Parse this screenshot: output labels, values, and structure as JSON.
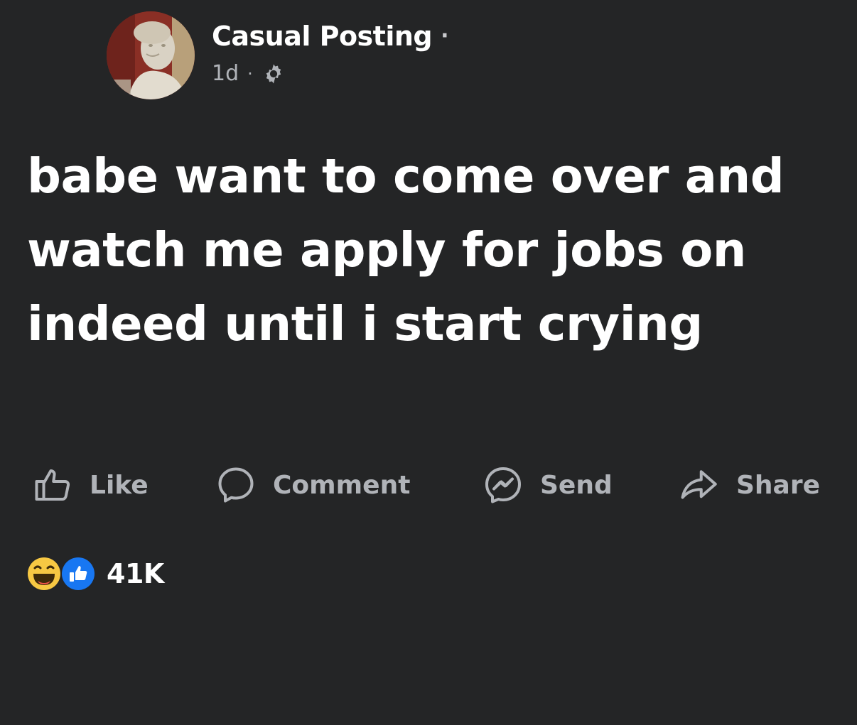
{
  "post": {
    "author": "Casual Posting",
    "author_separator": "·",
    "time": "1d",
    "time_separator": "·",
    "audience_icon": "gear-icon",
    "text": "babe want to come over and watch me apply for jobs on indeed until i start crying"
  },
  "actions": {
    "like": {
      "label": "Like",
      "icon": "thumbs-up-icon"
    },
    "comment": {
      "label": "Comment",
      "icon": "comment-bubble-icon"
    },
    "send": {
      "label": "Send",
      "icon": "messenger-icon"
    },
    "share": {
      "label": "Share",
      "icon": "share-arrow-icon"
    }
  },
  "reactions": {
    "icons": [
      "haha-emoji-icon",
      "like-reaction-icon"
    ],
    "count": "41K"
  },
  "colors": {
    "background": "#242526",
    "primary_text": "#ffffff",
    "secondary_text": "#b0b3b8",
    "like_blue": "#1877f2",
    "haha_yellow": "#f7c843"
  }
}
